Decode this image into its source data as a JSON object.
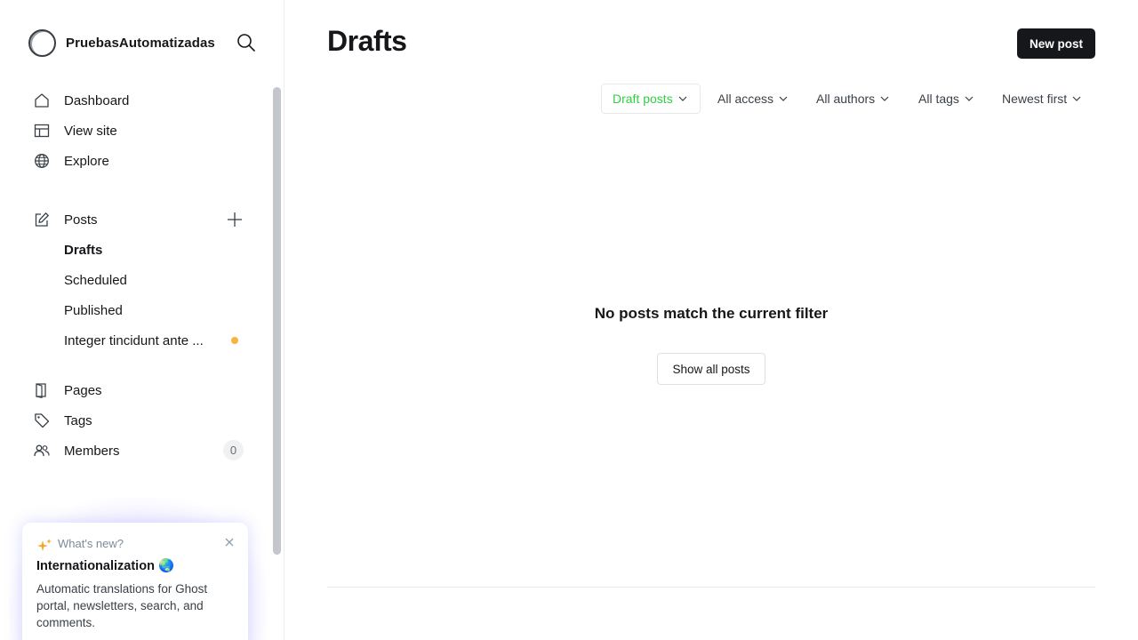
{
  "brand": {
    "name": "PruebasAutomatizadas"
  },
  "sidebar": {
    "primary": [
      {
        "label": "Dashboard",
        "icon": "home-icon"
      },
      {
        "label": "View site",
        "icon": "layout-icon"
      },
      {
        "label": "Explore",
        "icon": "globe-icon"
      }
    ],
    "posts": {
      "label": "Posts",
      "icon": "pencil-edit-icon",
      "sub_items": [
        {
          "label": "Drafts",
          "active": true
        },
        {
          "label": "Scheduled"
        },
        {
          "label": "Published"
        },
        {
          "label": "Integer tincidunt ante ...",
          "indicator_color": "#fbb13c"
        }
      ]
    },
    "secondary": [
      {
        "label": "Pages",
        "icon": "page-icon"
      },
      {
        "label": "Tags",
        "icon": "tag-icon"
      },
      {
        "label": "Members",
        "icon": "members-icon",
        "count": "0"
      }
    ]
  },
  "whats_new": {
    "label": "What's new?",
    "title": "Internationalization 🌏",
    "description": "Automatic translations for Ghost portal, newsletters, search, and comments."
  },
  "main": {
    "title": "Drafts",
    "new_post_label": "New post",
    "filters": {
      "type": "Draft posts",
      "access": "All access",
      "authors": "All authors",
      "tags": "All tags",
      "order": "Newest first"
    },
    "empty_state": {
      "message": "No posts match the current filter",
      "button": "Show all posts"
    }
  },
  "colors": {
    "accent_green": "#30cf43",
    "primary_button": "#15171a",
    "indicator_orange": "#fbb13c"
  }
}
